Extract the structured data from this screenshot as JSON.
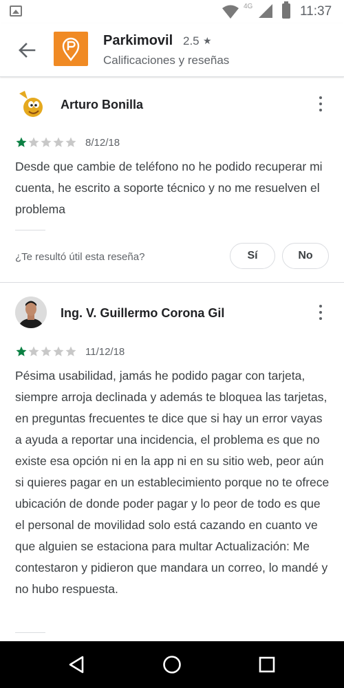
{
  "status_bar": {
    "network": "4G",
    "time": "11:37"
  },
  "app_bar": {
    "app_name": "Parkimovil",
    "rating": "2.5",
    "rating_star": "★",
    "subtitle": "Calificaciones y reseñas"
  },
  "reviews": [
    {
      "author": "Arturo Bonilla",
      "stars": 1,
      "date": "8/12/18",
      "text": "Desde que cambie de teléfono no he podido recuperar mi cuenta, he escrito a soporte técnico y no me resuelven el problema",
      "helpful_question": "¿Te resultó útil esta reseña?",
      "yes_label": "Sí",
      "no_label": "No"
    },
    {
      "author": "Ing. V. Guillermo Corona Gil",
      "stars": 1,
      "date": "11/12/18",
      "text": "Pésima usabilidad, jamás he podido pagar con tarjeta, siempre arroja declinada y además te bloquea las tarjetas, en preguntas frecuentes te dice que si hay un error vayas a ayuda a reportar una incidencia, el problema es que no existe esa opción ni en la app ni en su sitio web, peor aún si quieres pagar en un establecimiento porque no te ofrece ubicación de donde poder pagar y lo peor de todo es que el personal de movilidad solo está cazando en cuanto ve que alguien se estaciona para multar Actualización: Me contestaron y pidieron que mandara un correo, lo mandé y no hubo respuesta."
    }
  ],
  "colors": {
    "star_filled": "#0b8043",
    "star_empty": "#c8c8c8",
    "app_icon": "#f08a24"
  },
  "icons": {
    "back": "arrow-back-icon",
    "more": "more-vert-icon",
    "nav_back": "triangle-back-icon",
    "nav_home": "circle-home-icon",
    "nav_recents": "square-recents-icon"
  }
}
